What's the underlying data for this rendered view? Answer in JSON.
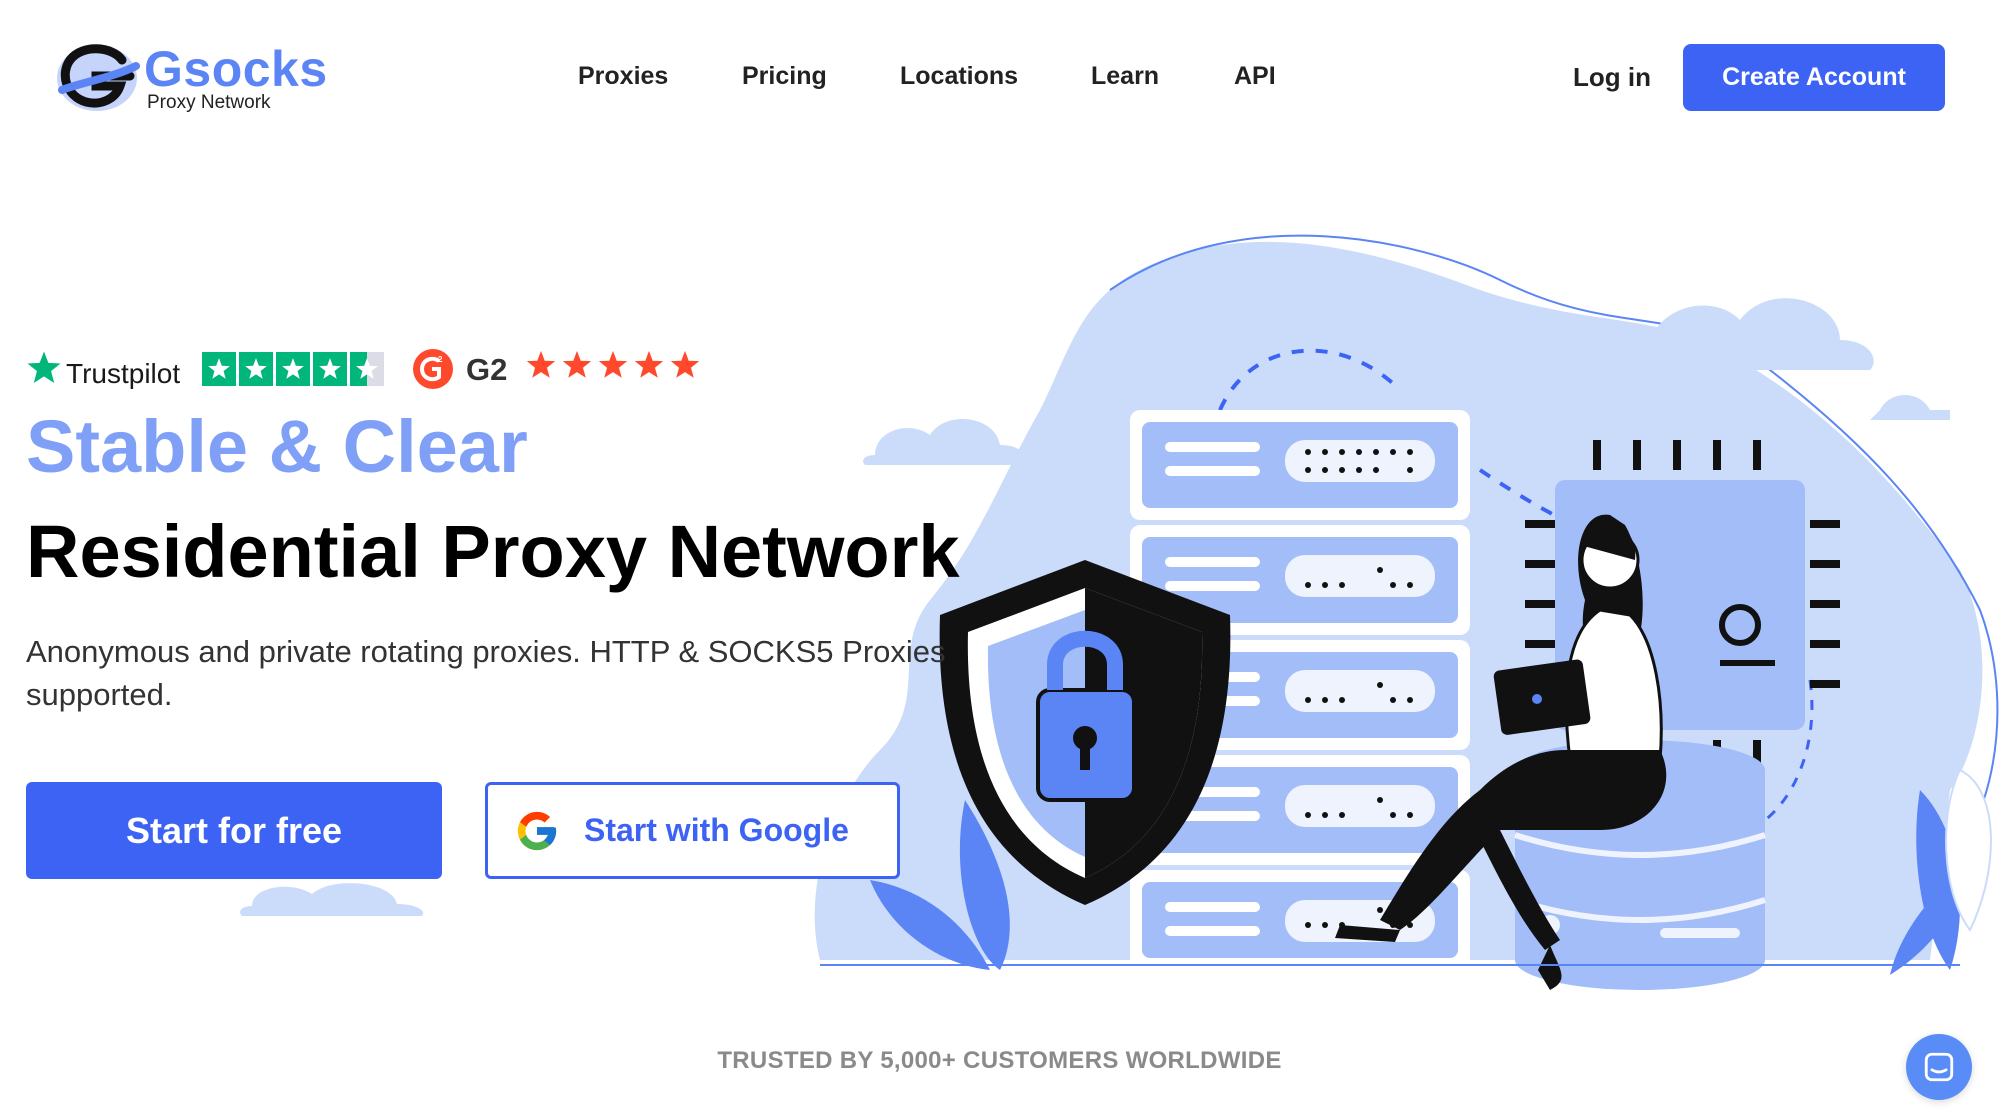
{
  "brand": {
    "name": "Gsocks",
    "tagline": "Proxy Network",
    "color": "#5b84f5"
  },
  "nav": {
    "items": [
      {
        "label": "Proxies"
      },
      {
        "label": "Pricing"
      },
      {
        "label": "Locations"
      },
      {
        "label": "Learn"
      },
      {
        "label": "API"
      }
    ],
    "login_label": "Log in",
    "create_account_label": "Create Account"
  },
  "ratings": {
    "trustpilot_label": "Trustpilot",
    "trustpilot_stars": 4.5,
    "g2_label": "G2",
    "g2_stars": 5
  },
  "hero": {
    "subtitle": "Stable & Clear",
    "title": "Residential Proxy Network",
    "description": "Anonymous and private rotating proxies. HTTP & SOCKS5 Proxies supported.",
    "primary_cta": "Start for free",
    "google_cta": "Start with Google"
  },
  "trusted_text": "TRUSTED BY 5,000+ CUSTOMERS WORLDWIDE",
  "colors": {
    "accent": "#3d63f5",
    "accent_light": "#7fa0f6",
    "illustration_blue": "#cbdcfb",
    "trustpilot_green": "#00b67a",
    "g2_red": "#ff492c"
  }
}
